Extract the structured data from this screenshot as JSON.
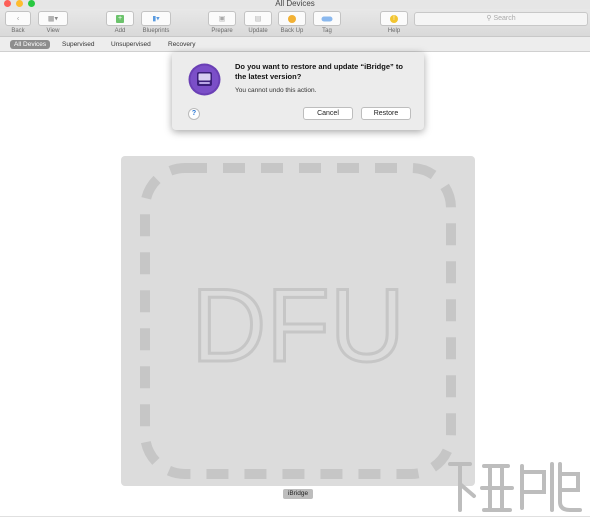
{
  "window": {
    "title": "All Devices"
  },
  "toolbar": {
    "items": [
      {
        "label": "Back",
        "icon": "chevron-left-icon"
      },
      {
        "label": "View",
        "icon": "grid-view-icon"
      },
      {
        "label": "Add",
        "icon": "plus-icon"
      },
      {
        "label": "Blueprints",
        "icon": "blueprints-icon"
      },
      {
        "label": "Prepare",
        "icon": "prepare-icon"
      },
      {
        "label": "Update",
        "icon": "update-icon"
      },
      {
        "label": "Back Up",
        "icon": "backup-icon"
      },
      {
        "label": "Tag",
        "icon": "tag-icon"
      },
      {
        "label": "Help",
        "icon": "help-icon"
      }
    ],
    "search_placeholder": "Search"
  },
  "tabs": [
    {
      "label": "All Devices",
      "active": true
    },
    {
      "label": "Supervised",
      "active": false
    },
    {
      "label": "Unsupervised",
      "active": false
    },
    {
      "label": "Recovery",
      "active": false
    }
  ],
  "dialog": {
    "title": "Do you want to restore and update “iBridge” to the latest version?",
    "message": "You cannot undo this action.",
    "cancel_label": "Cancel",
    "restore_label": "Restore",
    "help_label": "?",
    "icon": "configurator-app-icon",
    "icon_color": "#6a3fb5"
  },
  "device": {
    "mode_text": "DFU",
    "name": "iBridge"
  },
  "colors": {
    "accent": "#2a76d2",
    "card_bg": "#dcdcdc",
    "dfu_outline": "#c6c6c6"
  }
}
